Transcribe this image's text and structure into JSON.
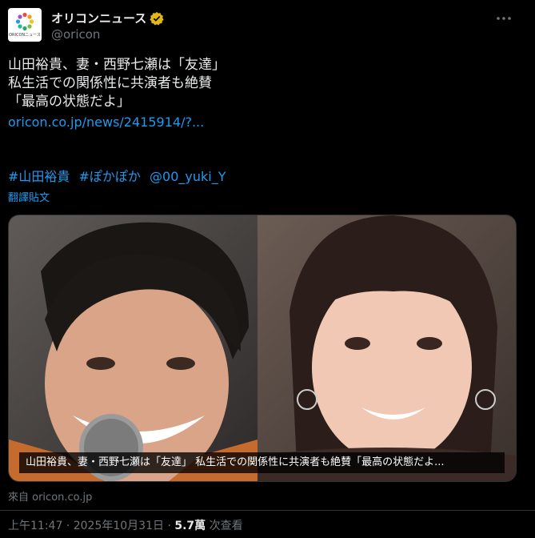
{
  "account": {
    "display_name": "オリコンニュース",
    "handle": "@oricon",
    "avatar_caption": "ORICONニュース"
  },
  "tweet": {
    "lines": [
      "山田裕貴、妻・西野七瀬は「友達」",
      "私生活での関係性に共演者も絶賛",
      "「最高の状態だよ」"
    ],
    "link_text": "oricon.co.jp/news/2415914/?...",
    "hashtags": [
      "#山田裕貴",
      "#ぽかぽか",
      "@00_yuki_Y"
    ],
    "translate_label": "翻譯貼文"
  },
  "media": {
    "caption": "山田裕貴、妻・西野七瀬は「友達」 私生活での関係性に共演者も絶賛「最高の状態だよ..."
  },
  "source_label": "來自 oricon.co.jp",
  "meta": {
    "time": "上午11:47",
    "date": "2025年10月31日",
    "separator": "·",
    "views_count": "5.7萬",
    "views_label": "次查看"
  },
  "colors": {
    "background": "#000000",
    "text": "#e7e9ea",
    "secondary": "#71767b",
    "link": "#1d9bf0",
    "verified": "#e2b719"
  }
}
